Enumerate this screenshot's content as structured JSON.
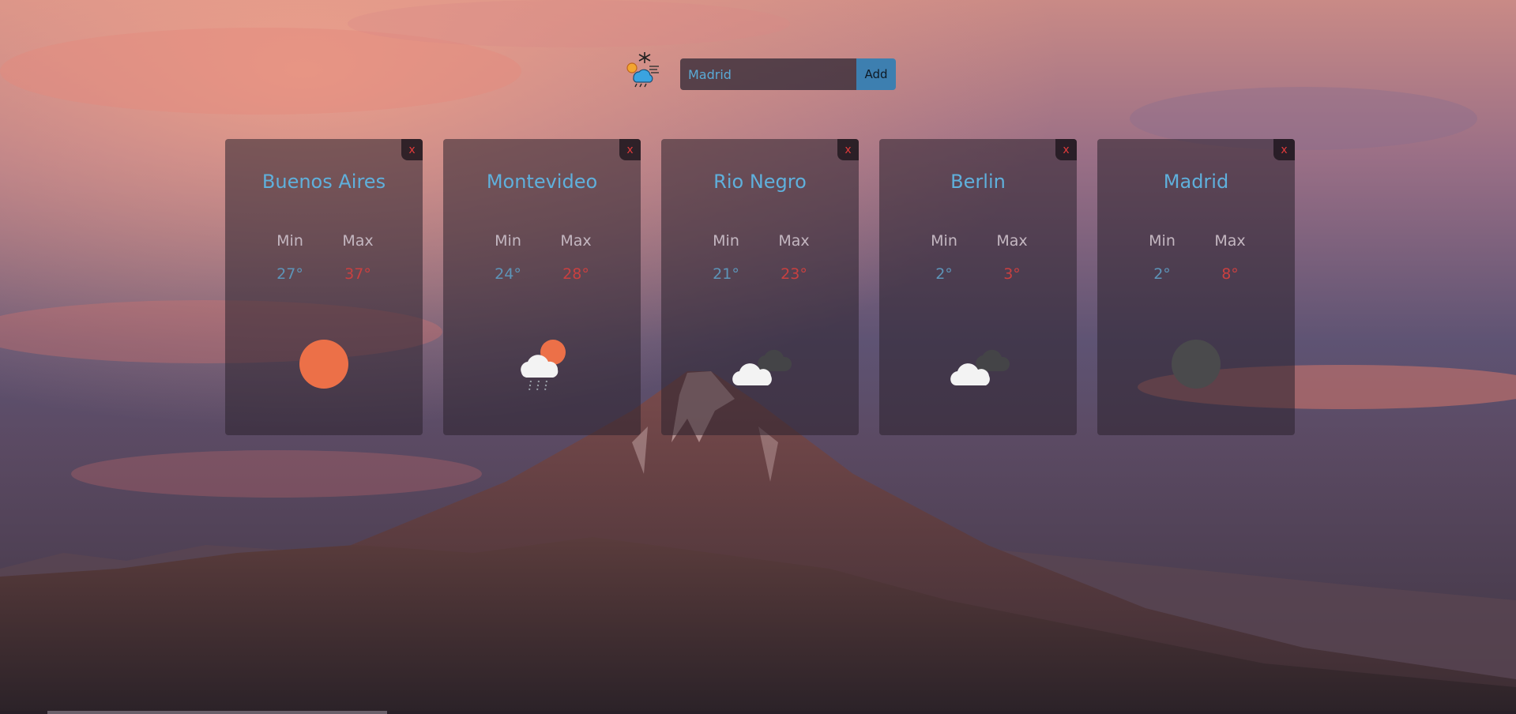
{
  "header": {
    "logo_icon": "weather-mix-icon",
    "search": {
      "value": "Madrid",
      "placeholder": ""
    },
    "add_label": "Add"
  },
  "colors": {
    "city": "#5fb0dc",
    "min_temp": "#5d94b8",
    "max_temp": "#c94040",
    "add_button": "#3d7fb0",
    "close_x": "#e23b3b"
  },
  "cards": [
    {
      "city": "Buenos Aires",
      "min_label": "Min",
      "max_label": "Max",
      "min": "27°",
      "max": "37°",
      "close": "x",
      "icon": "sun-icon"
    },
    {
      "city": "Montevideo",
      "min_label": "Min",
      "max_label": "Max",
      "min": "24°",
      "max": "28°",
      "close": "x",
      "icon": "sun-cloud-rain-icon"
    },
    {
      "city": "Rio Negro",
      "min_label": "Min",
      "max_label": "Max",
      "min": "21°",
      "max": "23°",
      "close": "x",
      "icon": "broken-clouds-icon"
    },
    {
      "city": "Berlin",
      "min_label": "Min",
      "max_label": "Max",
      "min": "2°",
      "max": "3°",
      "close": "x",
      "icon": "broken-clouds-icon"
    },
    {
      "city": "Madrid",
      "min_label": "Min",
      "max_label": "Max",
      "min": "2°",
      "max": "8°",
      "close": "x",
      "icon": "moon-night-icon"
    }
  ]
}
